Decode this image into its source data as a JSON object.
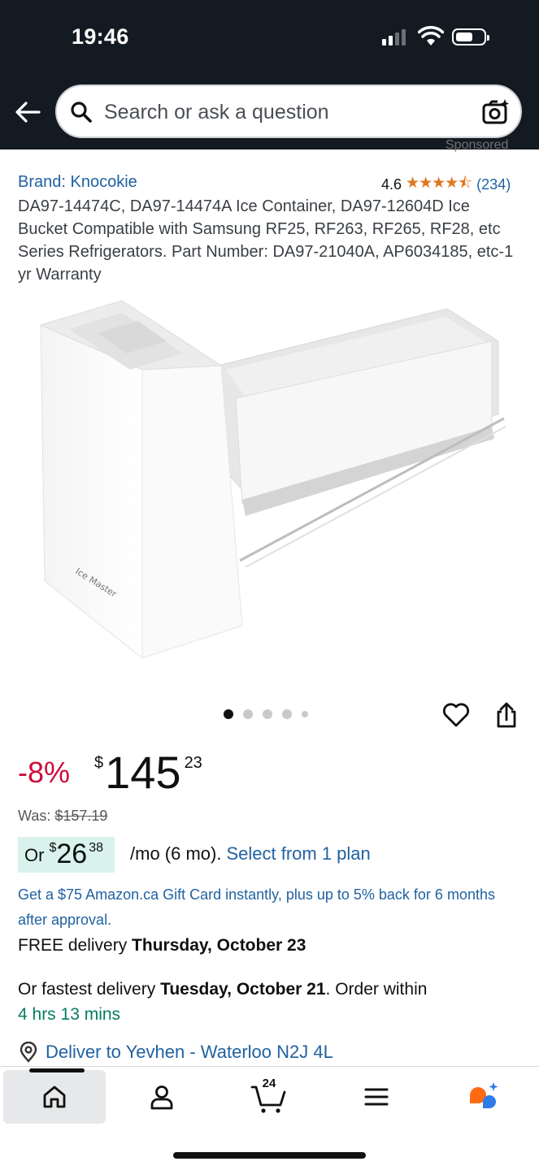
{
  "status_bar": {
    "time": "19:46"
  },
  "header": {
    "search_placeholder": "Search or ask a question"
  },
  "product": {
    "sponsored": "Sponsored",
    "brand": "Brand: Knocokie",
    "rating_value": "4.6",
    "rating_stars": 4.6,
    "rating_stars_text": "★★★★⯪",
    "rating_count": "(234)",
    "title": "DA97-14474C, DA97-14474A Ice Container, DA97-12604D Ice Bucket Compatible with Samsung RF25, RF263, RF265, RF28, etc Series Refrigerators. Part Number: DA97-21040A, AP6034185, etc-1 yr Warranty",
    "image_label": "Ice Master",
    "image_count": 5,
    "image_index": 1
  },
  "price": {
    "discount": "-8%",
    "currency": "$",
    "whole": "145",
    "fraction": "23",
    "was_label": "Was:",
    "was_price": "$157.19"
  },
  "financing": {
    "or": "Or",
    "currency": "$",
    "whole": "26",
    "fraction": "38",
    "terms": "/mo (6 mo).",
    "plan_link": "Select from 1 plan"
  },
  "promo": {
    "gift_card": "Get a $75 Amazon.ca Gift Card instantly, plus up to 5% back for 6 months after approval."
  },
  "delivery": {
    "free_prefix": "FREE delivery",
    "free_date": "Thursday, October 23",
    "fast_prefix": "Or fastest delivery",
    "fast_date": "Tuesday, October 21",
    "fast_suffix": ". Order within",
    "countdown": "4 hrs 13 mins",
    "deliver_to": "Deliver to Yevhen - Waterloo N2J 4L"
  },
  "bottom_nav": {
    "cart_count": "24"
  },
  "colors": {
    "header_bg": "#131a22",
    "link": "#2162a1",
    "discount": "#cc0c39",
    "star": "#de7921",
    "countdown": "#067d62",
    "finance_badge": "#d9f3ec"
  }
}
